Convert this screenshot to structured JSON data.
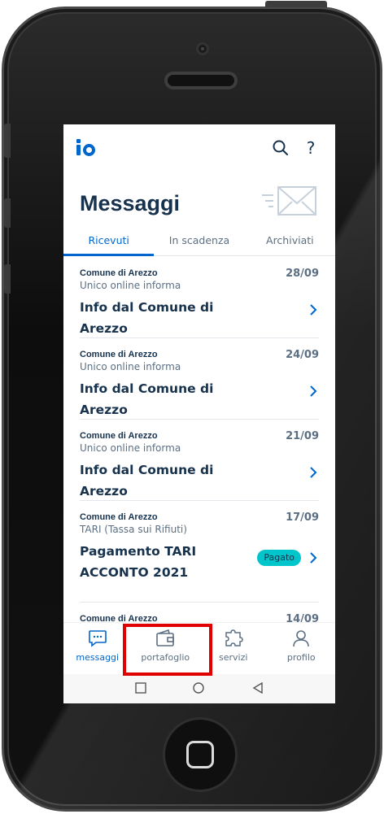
{
  "app": {
    "logo_text": "io"
  },
  "header": {
    "title": "Messaggi",
    "search_icon": "search-icon",
    "help_label": "?"
  },
  "tabs": [
    {
      "label": "Ricevuti",
      "active": true
    },
    {
      "label": "In scadenza",
      "active": false
    },
    {
      "label": "Archiviati",
      "active": false
    }
  ],
  "messages": [
    {
      "sender": "Comune di Arezzo",
      "service": "Unico online informa",
      "date": "28/09",
      "title": "Info dal Comune di Arezzo"
    },
    {
      "sender": "Comune di Arezzo",
      "service": "Unico online informa",
      "date": "24/09",
      "title": "Info dal Comune di Arezzo"
    },
    {
      "sender": "Comune di Arezzo",
      "service": "Unico online informa",
      "date": "21/09",
      "title": "Info dal Comune di Arezzo"
    },
    {
      "sender": "Comune di Arezzo",
      "service": "TARI (Tassa sui Rifiuti)",
      "date": "17/09",
      "title": "Pagamento TARI ACCONTO 2021",
      "badge": "Pagato"
    },
    {
      "sender": "Comune di Arezzo",
      "service": "",
      "date": "14/09",
      "title": ""
    }
  ],
  "bottom_nav": [
    {
      "label": "messaggi",
      "icon": "chat-icon",
      "active": true
    },
    {
      "label": "portafoglio",
      "icon": "wallet-icon",
      "active": false
    },
    {
      "label": "servizi",
      "icon": "puzzle-icon",
      "active": false
    },
    {
      "label": "profilo",
      "icon": "person-icon",
      "active": false
    }
  ],
  "system_nav": [
    "square-icon",
    "circle-icon",
    "triangle-back-icon"
  ],
  "colors": {
    "primary": "#0066cc",
    "text_dark": "#17324d",
    "text_muted": "#5c6f82",
    "badge": "#00c5ca",
    "highlight": "#e00000"
  }
}
